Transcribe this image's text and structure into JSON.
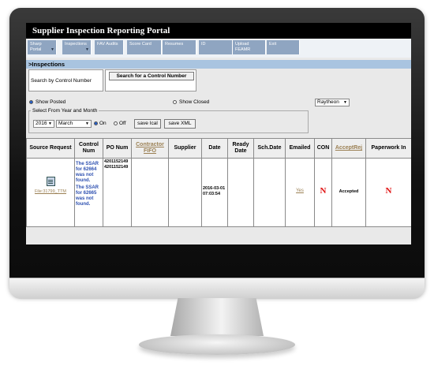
{
  "app": {
    "title": "Supplier Inspection Reporting Portal"
  },
  "menu": {
    "items": [
      {
        "line1": "Sharp",
        "line2": "Portal"
      },
      {
        "line1": "Inspections",
        "line2": ""
      },
      {
        "line1": "FAV Audits",
        "line2": ""
      },
      {
        "line1": "Score Card",
        "line2": ""
      },
      {
        "line1": "Resumes",
        "line2": ""
      },
      {
        "line1": "ID",
        "line2": ""
      },
      {
        "line1": "Upload",
        "line2": "FEAMR"
      },
      {
        "line1": "Exit",
        "line2": ""
      }
    ]
  },
  "section": {
    "title": ">Inspections"
  },
  "search": {
    "label": "Search by Control Number",
    "button": "Search for a Control Number"
  },
  "filters": {
    "show_posted": "Show Posted",
    "show_closed": "Show Closed",
    "customer": "Raytheon",
    "group_legend": "Select From Year and Month",
    "year": "2016",
    "month": "March",
    "on_label": "On",
    "off_label": "Off",
    "save_ical": "save Ical",
    "save_xml": "save XML"
  },
  "table": {
    "headers": {
      "source_request": "Source Request",
      "control_num": "Control Num",
      "po_num": "PO Num",
      "contractor_fifo": "Contractor FIFO",
      "supplier": "Supplier",
      "date": "Date",
      "ready_date": "Ready Date",
      "sch_date": "Sch.Date",
      "emailed": "Emailed",
      "con": "CON",
      "accept_rej": "AcceptRej",
      "paperwork_in": "Paperwork In"
    },
    "row": {
      "file_link": "File:31799_TTM",
      "control_msg_1": "The SSAR for 62664 was not found.",
      "control_msg_2": "The SSAR for 62665 was not found.",
      "po_1": "4201152149",
      "po_2": "4201152149",
      "date": "2016-03-01 07:03:54",
      "emailed": "Yes",
      "con": "N",
      "accept_rej": "Accepted",
      "paperwork_in": "N"
    }
  }
}
